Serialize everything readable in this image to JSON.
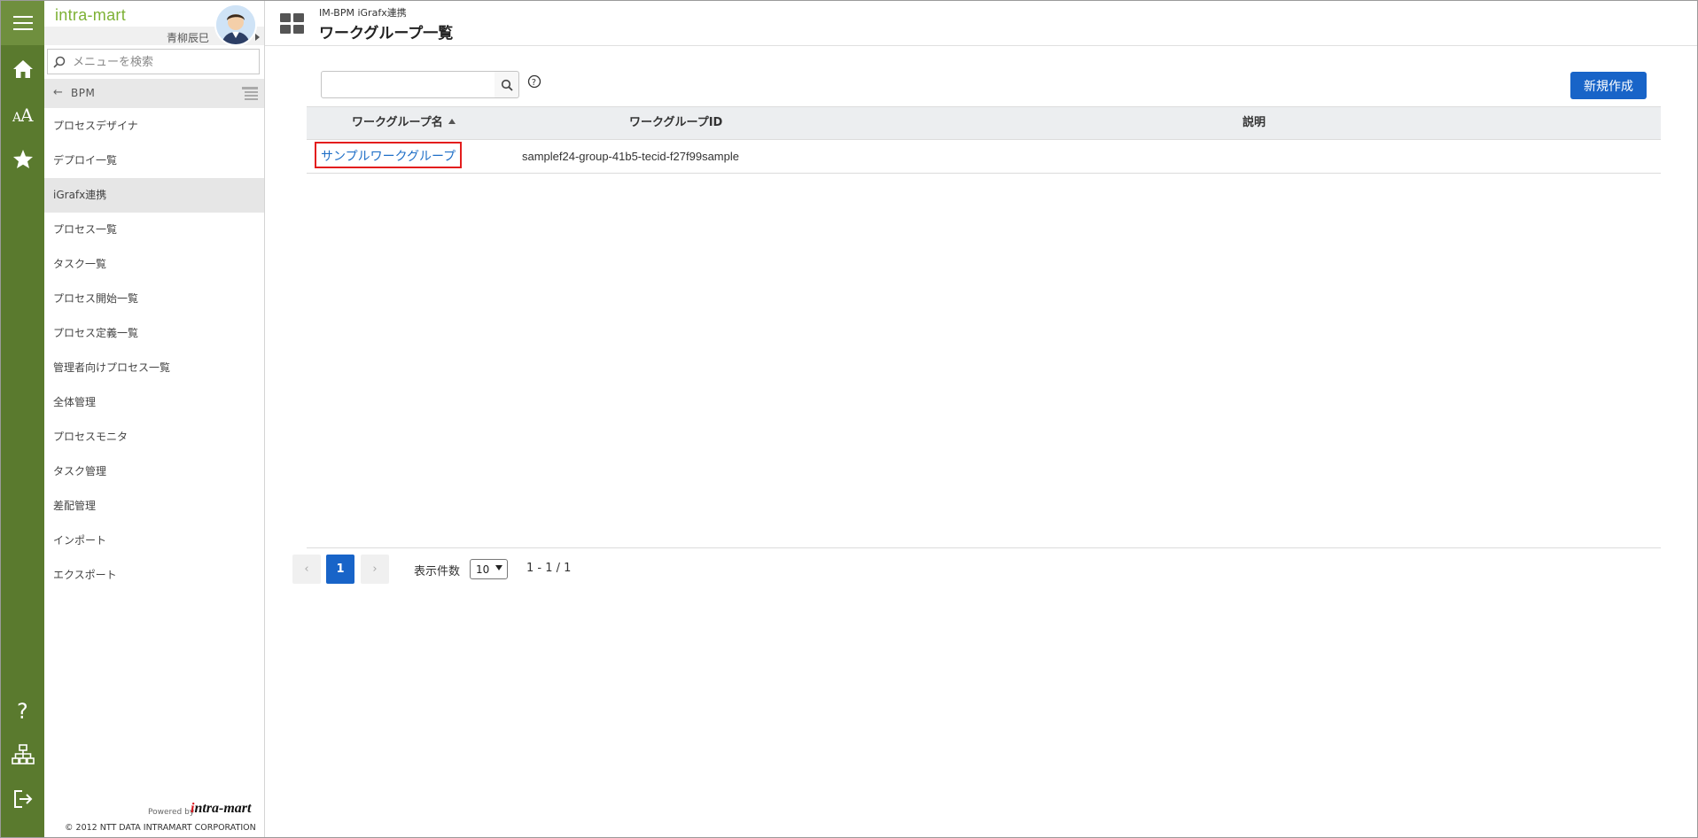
{
  "app": {
    "brand": "intra-mart",
    "user_name": "青柳辰巳",
    "search_placeholder": "メニューを検索",
    "back_label": "BPM",
    "back_arrow": "←",
    "powered_by": "Powered by",
    "logo_text": "intra-mart",
    "copyright": "© 2012 NTT DATA INTRAMART CORPORATION"
  },
  "sidebar": {
    "items": [
      {
        "label": "プロセスデザイナ"
      },
      {
        "label": "デプロイ一覧"
      },
      {
        "label": "iGrafx連携",
        "active": true
      },
      {
        "label": "プロセス一覧"
      },
      {
        "label": "タスク一覧"
      },
      {
        "label": "プロセス開始一覧"
      },
      {
        "label": "プロセス定義一覧"
      },
      {
        "label": "管理者向けプロセス一覧"
      },
      {
        "label": "全体管理"
      },
      {
        "label": "プロセスモニタ"
      },
      {
        "label": "タスク管理"
      },
      {
        "label": "差配管理"
      },
      {
        "label": "インポート"
      },
      {
        "label": "エクスポート"
      }
    ]
  },
  "header": {
    "breadcrumb": "IM-BPM iGrafx連携",
    "title": "ワークグループ一覧"
  },
  "toolbar": {
    "search_value": "",
    "new_label": "新規作成"
  },
  "table": {
    "columns": [
      "ワークグループ名",
      "ワークグループID",
      "説明"
    ],
    "sorted_column": "ワークグループ名",
    "sort_direction": "ascending",
    "rows": [
      {
        "name": "サンプルワークグループ",
        "id": "samplef24-group-41b5-tecid-f27f99sample",
        "description": ""
      }
    ]
  },
  "pager": {
    "prev": "‹",
    "current": "1",
    "next": "›",
    "per_page_label": "表示件数",
    "per_page": "10",
    "range": "1 - 1 / 1"
  },
  "colors": {
    "rail": "#5a7a2e",
    "brand": "#7db135",
    "accent": "#1864c8",
    "highlight": "#e31d1d"
  },
  "icons": {
    "rail_top": [
      "menu-icon",
      "home-icon",
      "font-size-icon",
      "star-icon"
    ],
    "rail_bottom": [
      "help-icon",
      "sitemap-icon",
      "logout-icon"
    ]
  }
}
